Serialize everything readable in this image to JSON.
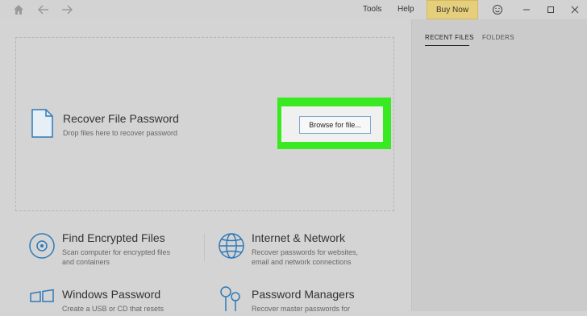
{
  "menu": {
    "tools": "Tools",
    "help": "Help",
    "buy_now": "Buy Now"
  },
  "right_panel": {
    "tabs": [
      "RECENT FILES",
      "FOLDERS"
    ]
  },
  "recover": {
    "title": "Recover File Password",
    "subtitle": "Drop files here to recover password",
    "browse_label": "Browse for file..."
  },
  "tiles": [
    {
      "title": "Find Encrypted Files",
      "desc1": "Scan computer for encrypted files",
      "desc2": "and containers",
      "icon": "disc-icon"
    },
    {
      "title": "Internet & Network",
      "desc1": "Recover passwords for websites,",
      "desc2": "email and network connections",
      "icon": "globe-icon"
    },
    {
      "title": "Windows Password",
      "desc1": "Create a USB or CD that resets",
      "desc2": "",
      "icon": "windows-icon"
    },
    {
      "title": "Password Managers",
      "desc1": "Recover master passwords for",
      "desc2": "",
      "icon": "keys-icon"
    }
  ],
  "colors": {
    "background": "#d3d3d3",
    "buy_now": "#e6cf7c",
    "highlight": "#39ea22",
    "icon_blue": "#2e7ab8"
  }
}
